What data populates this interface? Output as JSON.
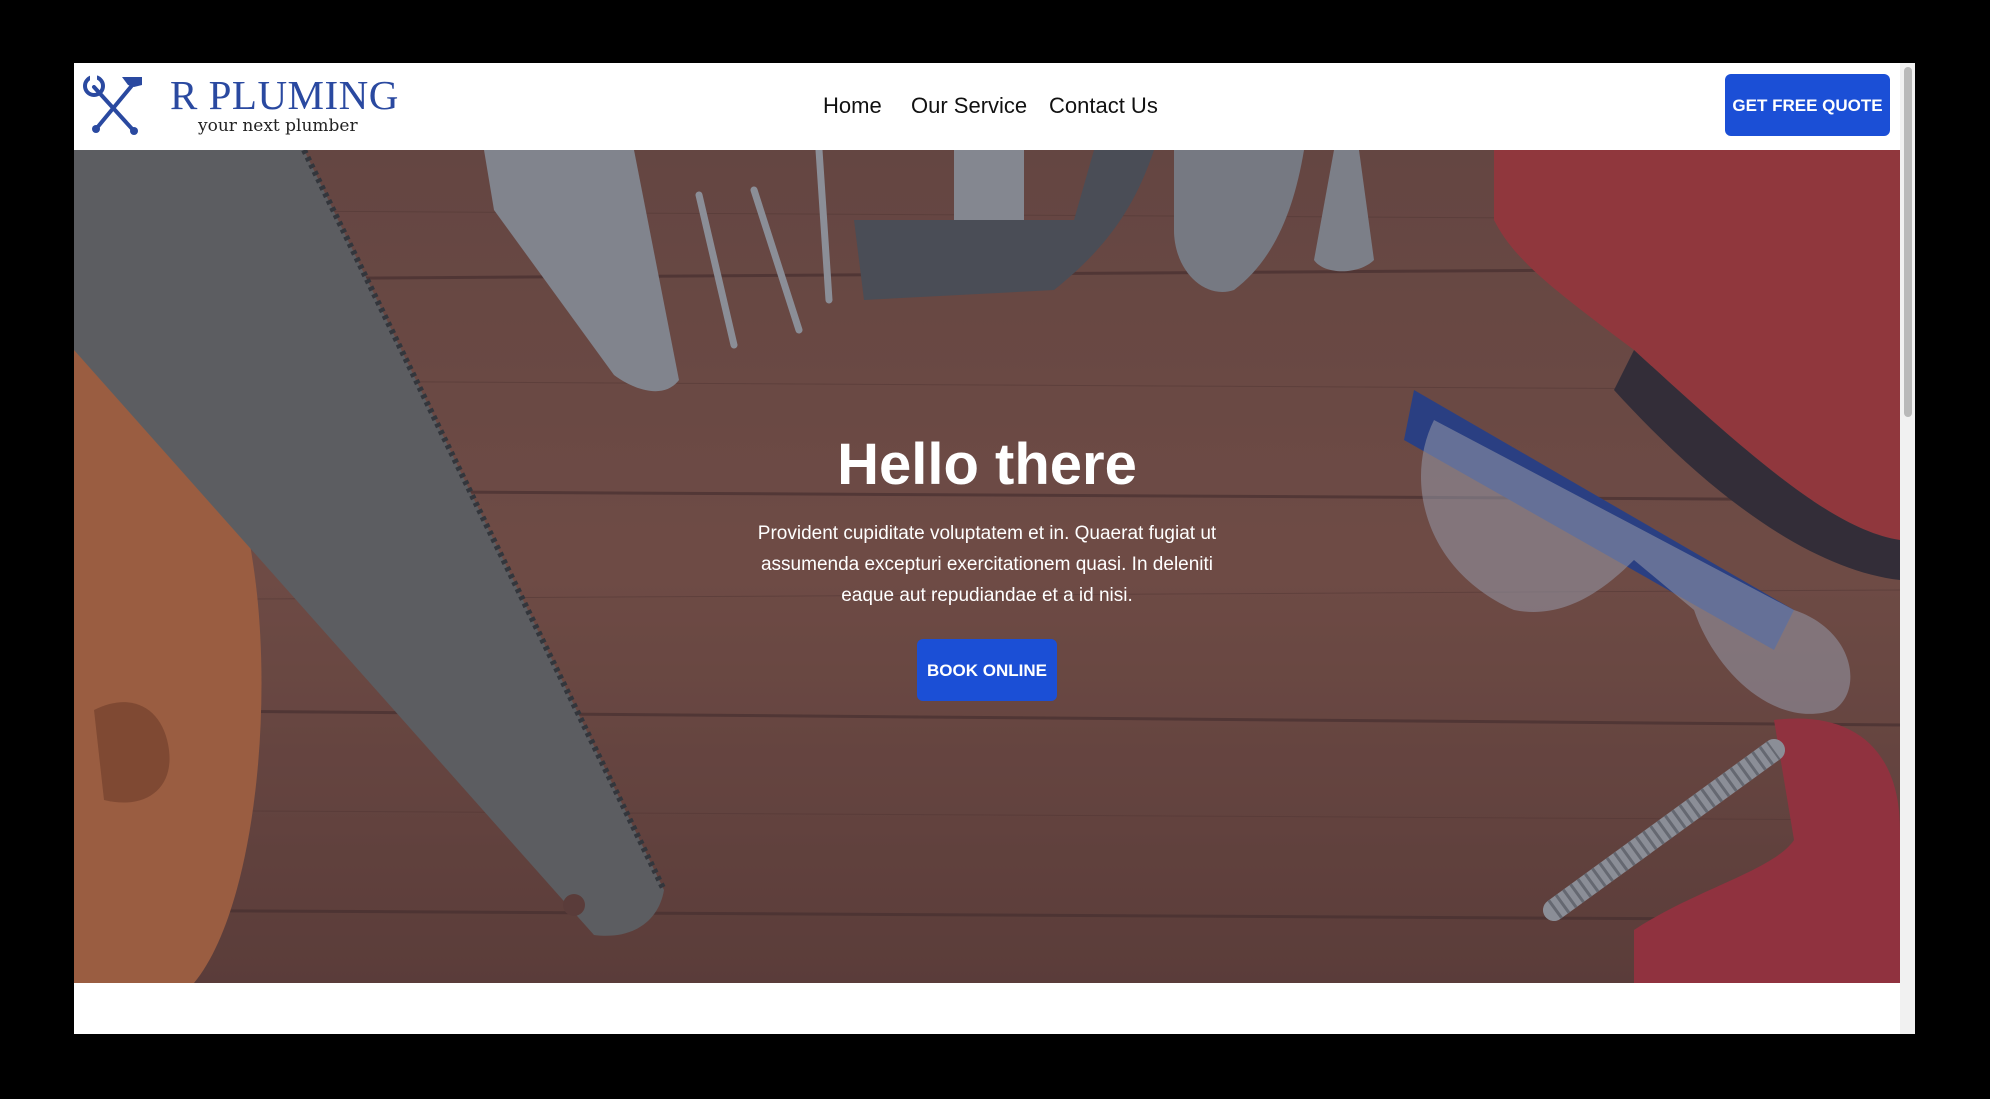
{
  "brand": {
    "name": "R PLUMING",
    "tagline": "your next plumber",
    "logo_icon": "crossed-wrench-hammer-icon",
    "color": "#2a49a0"
  },
  "nav": {
    "items": [
      {
        "label": "Home"
      },
      {
        "label": "Our Service"
      },
      {
        "label": "Contact Us"
      }
    ],
    "cta_label": "GET FREE QUOTE"
  },
  "hero": {
    "title": "Hello there",
    "text": "Provident cupiditate voluptatem et in. Quaerat fugiat ut assumenda excepturi exercitationem quasi. In deleniti eaque aut repudiandae et a id nisi.",
    "button_label": "BOOK ONLINE",
    "background": "tools-on-wooden-table"
  },
  "colors": {
    "accent": "#1b4fd6",
    "page_frame": "#000000"
  }
}
